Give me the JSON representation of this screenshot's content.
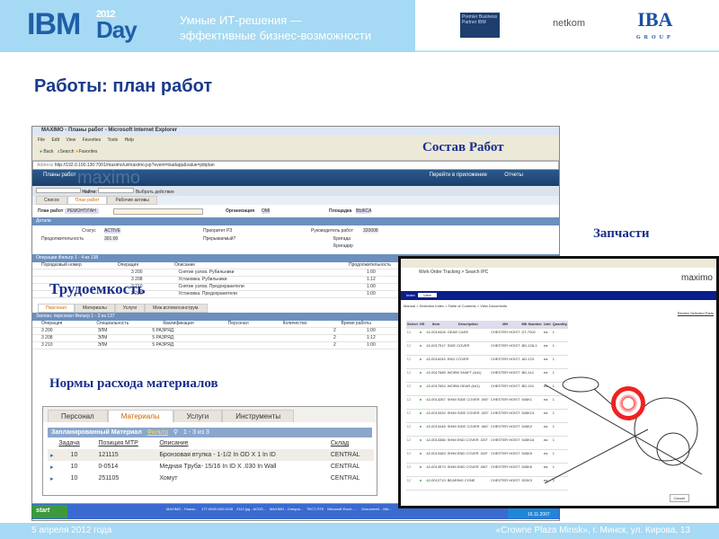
{
  "header": {
    "logo_main": "IBM",
    "logo_day": "Day",
    "logo_year": "2012",
    "tagline_line1": "Умные ИТ-решения —",
    "tagline_line2": "эффективные бизнес-возможности",
    "partner1": "Premier Business Partner IBM",
    "partner2": "netkom",
    "partner3_main": "IBA",
    "partner3_sub": "GROUP"
  },
  "slide_title": "Работы: план работ",
  "labels": {
    "composition": "Состав Работ",
    "parts": "Запчасти",
    "labor": "Трудоемкость",
    "materials_norms": "Нормы расхода материалов"
  },
  "ie": {
    "title": "MAXIMO - Планы работ - Microsoft Internet Explorer",
    "menu": [
      "File",
      "Edit",
      "View",
      "Favorites",
      "Tools",
      "Help"
    ],
    "back": "Back",
    "search": "Search",
    "favorites": "Favorites",
    "address_label": "Address",
    "address": "http://192.0.100.130:7001/maximo/ui/maximo.jsp?event=loadapp&value=jobplan",
    "app_title": "Планы работ",
    "brand": "maximo",
    "goto": "Перейти в приложение",
    "reports": "Отчеты",
    "find_label": "Найти:",
    "action_select": "Выбрать действие",
    "tabs": [
      "Список",
      "План работ",
      "Рабочие активы"
    ],
    "form": {
      "plan_label": "План работ",
      "plan_value": "РЕМОНТ/ГАН",
      "org_label": "Организация",
      "org_value": "OMI",
      "site_label": "Площадка",
      "site_value": "ВЫКСА",
      "details": "Детали",
      "status_label": "Статус",
      "status_value": "ACTIVE",
      "duration_label": "Продолжительность",
      "duration_value": "301:00",
      "priority_label": "Приоритет РЗ",
      "interrupt_label": "Прерываемый?",
      "supervisor_label": "Руководитель работ",
      "supervisor_value": "320008",
      "crew_label": "Бригада",
      "foreman_label": "Бригадир"
    },
    "ops": {
      "bar": "Операции",
      "filter": "Фильтр",
      "pager": "1 - 4 из 138",
      "cols": [
        "Порядковый номер",
        "Операция",
        "Описание",
        "Продолжительность"
      ],
      "rows": [
        [
          "3 200",
          "Снятие узлов. Рубильники",
          "1:00"
        ],
        [
          "3 208",
          "Установка. Рубильники",
          "1:12"
        ],
        [
          "3 210",
          "Снятие узлов. Предохранители",
          "1:00"
        ],
        [
          "3 220",
          "Установка. Предохранители",
          "1:00"
        ]
      ]
    },
    "subtabs": [
      "Персонал",
      "Материалы",
      "Услуги",
      "Меж.вспомог.инструм."
    ],
    "labor": {
      "bar": "Заплан. персонал",
      "filter": "Фильтр",
      "pager": "1 - 3 из 137",
      "cols": [
        "Операция",
        "Специальность",
        "Квалификация",
        "Персонал",
        "Количество",
        "Время работы"
      ],
      "rows": [
        [
          "3 200",
          "ЭЛМ",
          "5 РАЗРЯД",
          "2",
          "1:00"
        ],
        [
          "3 208",
          "ЭЛМ",
          "5 РАЗРЯД",
          "2",
          "1:12"
        ],
        [
          "3 210",
          "ЭЛМ",
          "5 РАЗРЯД",
          "2",
          "1:00"
        ]
      ]
    },
    "start": "start",
    "tasks": [
      "MAXIMO - Плана...",
      "177-0000-000-0105",
      "2112.jpg - ACDS...",
      "MAXIMO - Спецна...",
      "TECT-ПТК",
      "Microsoft Excel - ...",
      "Document1 - Mic..."
    ],
    "clock": "16.11.2007"
  },
  "materials": {
    "tabs": [
      "Персонал",
      "Материалы",
      "Услуги",
      "Инструменты"
    ],
    "bar": "Запланированный Материал",
    "filter": "Фильтр",
    "pager": "1 - 3 из 3",
    "cols": [
      "Задача",
      "Позиция МТР",
      "Описание",
      "Склад"
    ],
    "rows": [
      [
        "10",
        "121115",
        "Бронзовая втулка - 1-1/2 In OD X 1 In ID",
        "CENTRAL"
      ],
      [
        "10",
        "0-0514",
        "Медная Труба- 15/16 In ID X .030 In Wall",
        "CENTRAL"
      ],
      [
        "10",
        "251105",
        "Хомут",
        "CENTRAL"
      ]
    ]
  },
  "ipc": {
    "title": "Work Order Tracking > Search IPC",
    "brand": "maximo",
    "nav": [
      "Index",
      "View"
    ],
    "breadcrumb": "Manual > Selection Index > Table of Contents > View Documents",
    "review": "Review Selected Parts",
    "cancel": "Cancel",
    "cols": [
      "Select",
      "HS",
      "Item",
      "Description",
      "Mfr",
      "Mfr Number",
      "Unit",
      "Quantity"
    ],
    "rows": [
      [
        "42-0019426",
        "GEAR CASE",
        "CHESTER HOIST",
        "DT-7002",
        "ea",
        "1"
      ],
      [
        "42-0017917",
        "SIDE COVER",
        "CHESTER HOIST",
        "BD-128-1",
        "ea",
        "1"
      ],
      [
        "42-0015245",
        "END COVER",
        "CHESTER HOIST",
        "AD-123",
        "ea",
        "1"
      ],
      [
        "42-0017685",
        "WORM SHAFT (641)",
        "CHESTER HOIST",
        "BD-114",
        "ea",
        "1"
      ],
      [
        "42-0017654",
        "WORM GEAR (641)",
        "CHESTER HOIST",
        "BD-115",
        "ea",
        "1"
      ],
      [
        "42-0013267",
        "SHIM SIDE COVER .005\"",
        "CHESTER HOIST",
        "545K1",
        "ea",
        "1"
      ],
      [
        "42-0013334",
        "SHIM SIDE COVER .020\"",
        "CHESTER HOIST",
        "545K13",
        "ea",
        "1"
      ],
      [
        "42-0013446",
        "SHIM SIDE COVER .060\"",
        "CHESTER HOIST",
        "545K2",
        "ea",
        "1"
      ],
      [
        "42-0013386",
        "SHIM END COVER .020\"",
        "CHESTER HOIST",
        "545K16",
        "ea",
        "1"
      ],
      [
        "42-0013483",
        "SHIM END COVER .005\"",
        "CHESTER HOIST",
        "545K5",
        "ea",
        "1"
      ],
      [
        "42-0013573",
        "SHIM END COVER .060\"",
        "CHESTER HOIST",
        "545K6",
        "ea",
        "1"
      ],
      [
        "42-0012713",
        "BEARING CONE",
        "CHESTER HOIST",
        "520K3",
        "ea",
        "2"
      ]
    ]
  },
  "footer": {
    "date": "5 апреля 2012 года",
    "venue": "«Crowne Plaza Minsk», г. Минск, ул. Кирова, 13"
  }
}
